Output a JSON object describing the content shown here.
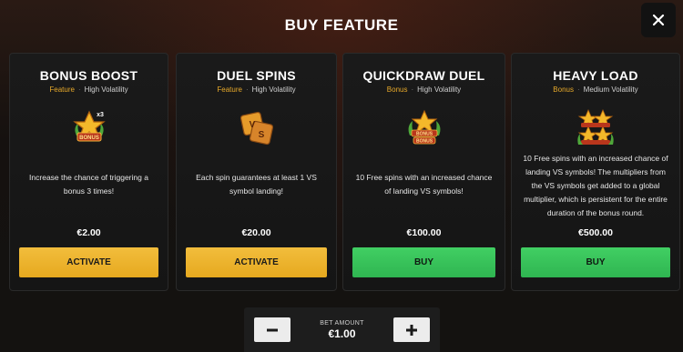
{
  "header": {
    "title": "BUY FEATURE"
  },
  "cards": [
    {
      "title": "BONUS BOOST",
      "type": "Feature",
      "volatility": "High Volatility",
      "icon": "star-bonus-x3-icon",
      "description": "Increase the chance of triggering a bonus 3 times!",
      "price": "€2.00",
      "button": "ACTIVATE"
    },
    {
      "title": "DUEL SPINS",
      "type": "Feature",
      "volatility": "High Volatility",
      "icon": "vs-symbol-icon",
      "description": "Each spin guarantees at least 1 VS symbol landing!",
      "price": "€20.00",
      "button": "ACTIVATE"
    },
    {
      "title": "QUICKDRAW DUEL",
      "type": "Bonus",
      "volatility": "High Volatility",
      "icon": "bonus-bonus-stars-icon",
      "description": "10 Free spins with an increased chance of landing VS symbols!",
      "price": "€100.00",
      "button": "BUY"
    },
    {
      "title": "HEAVY LOAD",
      "type": "Bonus",
      "volatility": "Medium Volatility",
      "icon": "bonus-stack-icon",
      "description": "10 Free spins with an increased chance of landing VS symbols! The multipliers from the VS symbols get added to a global multiplier, which is persistent for the entire duration of the bonus round.",
      "price": "€500.00",
      "button": "BUY"
    }
  ],
  "bet": {
    "label": "BET AMOUNT",
    "value": "€1.00",
    "minus_icon": "minus-icon",
    "plus_icon": "plus-icon"
  },
  "colors": {
    "accent_gold": "#e7a92a",
    "activate_button": "#eab02a",
    "buy_button": "#39c25b",
    "card_bg": "#181818"
  }
}
